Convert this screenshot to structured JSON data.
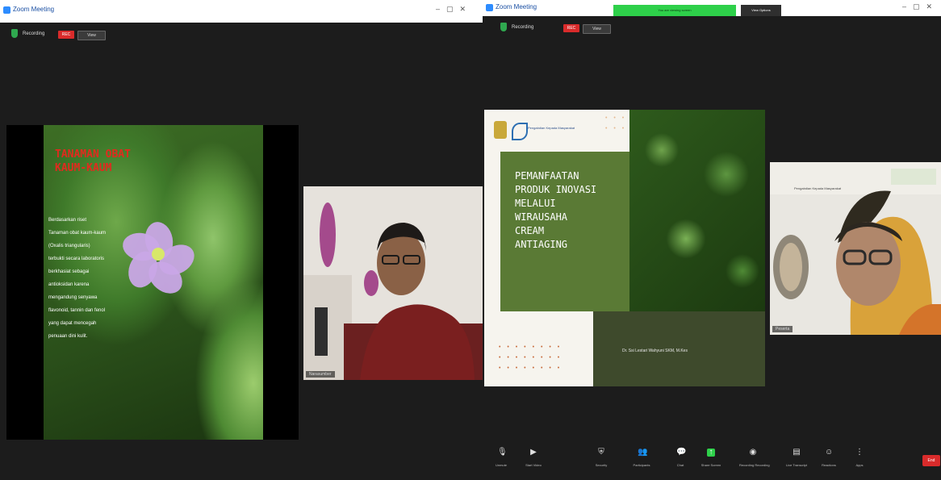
{
  "left_window": {
    "title": "Zoom Meeting",
    "recording_label": "Recording",
    "rec_button": "REC",
    "view_button": "View",
    "slide": {
      "title_line1": "TANAMAN OBAT",
      "title_line2": "KAUM-KAUM",
      "body_lines": [
        "Berdasarkan riset",
        "Tanaman obat kaum-kaum",
        "(Oxalis triangularis)",
        "terbukti secara laboratoris",
        "berkhasiat sebagai",
        "antioksidan karena",
        "mengandung senyawa",
        "flavonoid, tannin dan fenol",
        "yang dapat mencegah",
        "penuaan dini kulit."
      ]
    },
    "participant_name": "Narasumber"
  },
  "right_window": {
    "title": "Zoom Meeting",
    "banner_text": "You are viewing screen",
    "view_options": "View Options",
    "recording_label": "Recording",
    "rec_button": "REC",
    "view_button": "View",
    "slide": {
      "logo_text": "Pengabdian Kepada Masyarakat",
      "title_lines": [
        "PEMANFAATAN",
        "PRODUK INOVASI",
        "MELALUI",
        "WIRAUSAHA",
        "CREAM",
        "ANTIAGING"
      ],
      "author": "Dr. Ssi Lestari Wahyuni SKM, M.Kes"
    },
    "participant_name": "Peserta",
    "participant_banner": "Pengabdian Kepada Masyarakat"
  },
  "toolbar": {
    "items": [
      {
        "label": "Unmute",
        "icon": "microphone-icon"
      },
      {
        "label": "Start Video",
        "icon": "video-icon"
      },
      {
        "label": "Security",
        "icon": "shield-icon"
      },
      {
        "label": "Participants",
        "icon": "participants-icon"
      },
      {
        "label": "Chat",
        "icon": "chat-icon"
      },
      {
        "label": "Share Screen",
        "icon": "share-screen-icon"
      },
      {
        "label": "Recording Recording",
        "icon": "record-icon"
      },
      {
        "label": "Live Transcript",
        "icon": "transcript-icon"
      },
      {
        "label": "Reactions",
        "icon": "reactions-icon"
      },
      {
        "label": "Apps",
        "icon": "apps-icon"
      }
    ],
    "end_label": "End"
  },
  "colors": {
    "zoom_dark": "#1c1c1c",
    "rec_red": "#d92b2b",
    "share_green": "#2ed04a",
    "slide_title_red": "#e22a1e",
    "slide_green": "#5a7a35"
  }
}
